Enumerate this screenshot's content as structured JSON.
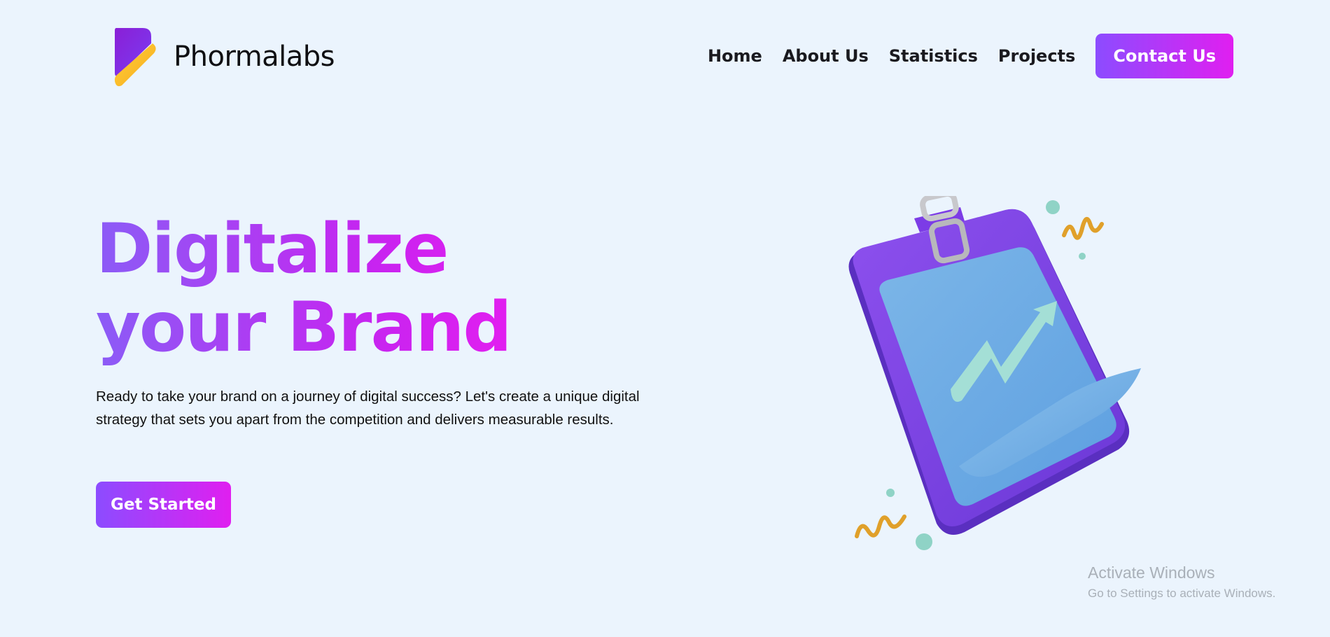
{
  "brand": {
    "name": "Phormalabs",
    "logo_icon": "phormalabs-logo-icon"
  },
  "nav": {
    "links": [
      "Home",
      "About Us",
      "Statistics",
      "Projects"
    ],
    "contact_label": "Contact Us"
  },
  "hero": {
    "title": "Digitalize your Brand",
    "description": "Ready to take your brand on a journey of digital success? Let's create a unique digital strategy that sets you apart from the competition and delivers measurable results.",
    "cta_label": "Get Started",
    "illustration_icon": "clipboard-growth-chart-icon"
  },
  "watermark": {
    "title": "Activate Windows",
    "subtitle": "Go to Settings to activate Windows."
  },
  "colors": {
    "background": "#ebf4fd",
    "gradient_start": "#8c4cff",
    "gradient_end": "#e01ff0"
  }
}
